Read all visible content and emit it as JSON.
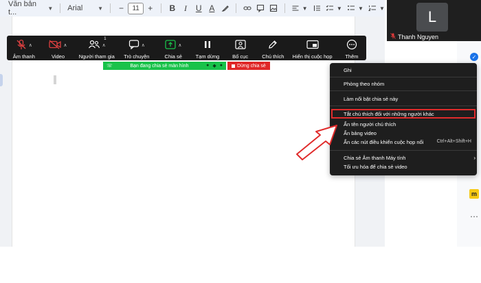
{
  "docs_toolbar": {
    "style_dropdown": "Văn bản t...",
    "font_dropdown": "Arial",
    "minus": "−",
    "font_size": "11",
    "plus": "+",
    "bold": "B",
    "italic": "I",
    "underline": "U",
    "text_color": "A"
  },
  "participant": {
    "initial": "L",
    "name": "Thanh Nguyen"
  },
  "zoom_toolbar": {
    "items": [
      {
        "label": "Âm thanh"
      },
      {
        "label": "Video"
      },
      {
        "label": "Người tham gia",
        "badge": "1"
      },
      {
        "label": "Trò chuyện"
      },
      {
        "label": "Chia sẻ"
      },
      {
        "label": "Tạm dừng"
      },
      {
        "label": "Bố cục"
      },
      {
        "label": "Chú thích"
      },
      {
        "label": "Hiển thị cuộc họp"
      },
      {
        "label": "Thêm"
      }
    ]
  },
  "share_banner": {
    "text": "Bạn đang chia sẻ màn hình",
    "stop_label": "Dừng chia sẻ"
  },
  "more_menu": {
    "items": [
      {
        "label": "Ghi"
      },
      {
        "label": "Phòng theo nhóm"
      },
      {
        "label": "Làm nổi bật chia sẻ này"
      },
      {
        "label": "Tắt chú thích đối với những người khác"
      },
      {
        "label": "Ẩn tên người chú thích"
      },
      {
        "label": "Ẩn bảng video"
      },
      {
        "label": "Ẩn các nút điều khiển cuộc họp nổi",
        "shortcut": "Ctrl+Alt+Shift+H"
      },
      {
        "label": "Chia sẻ Âm thanh Máy tính"
      },
      {
        "label": "Tối ưu hóa để chia sẻ video"
      }
    ]
  },
  "colors": {
    "banner_green": "#19c24a",
    "stop_red": "#e02828",
    "highlight_red": "#e02b2b",
    "toolbar_dark": "#1a1a1a"
  }
}
